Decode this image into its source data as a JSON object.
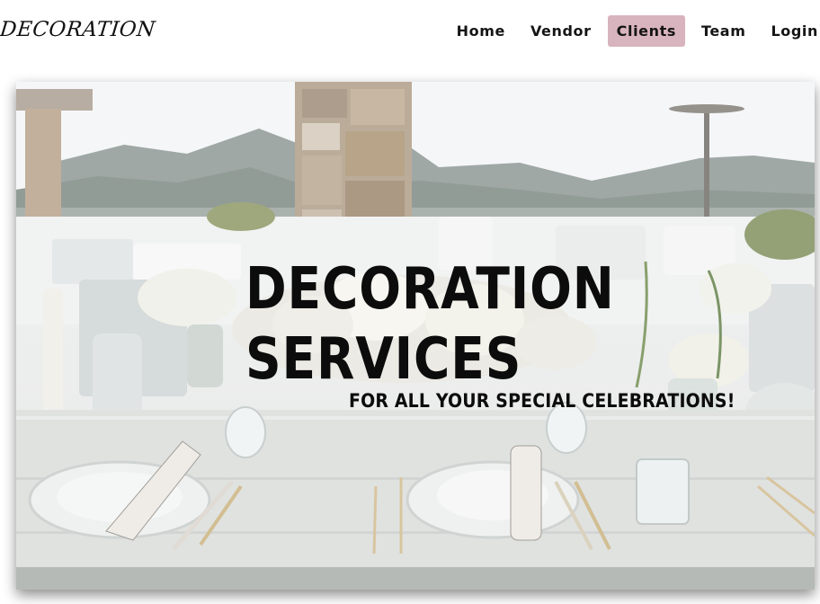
{
  "header": {
    "logo": "DECORATION",
    "nav": [
      {
        "label": "Home"
      },
      {
        "label": "Vendor"
      },
      {
        "label": "Clients",
        "active": true
      },
      {
        "label": "Team"
      },
      {
        "label": "Login"
      }
    ],
    "active_color": "#d8b4be"
  },
  "hero": {
    "title_line1": "DECORATION",
    "title_line2": "SERVICES",
    "subtitle": "FOR ALL YOUR SPECIAL CELEBRATIONS!"
  }
}
